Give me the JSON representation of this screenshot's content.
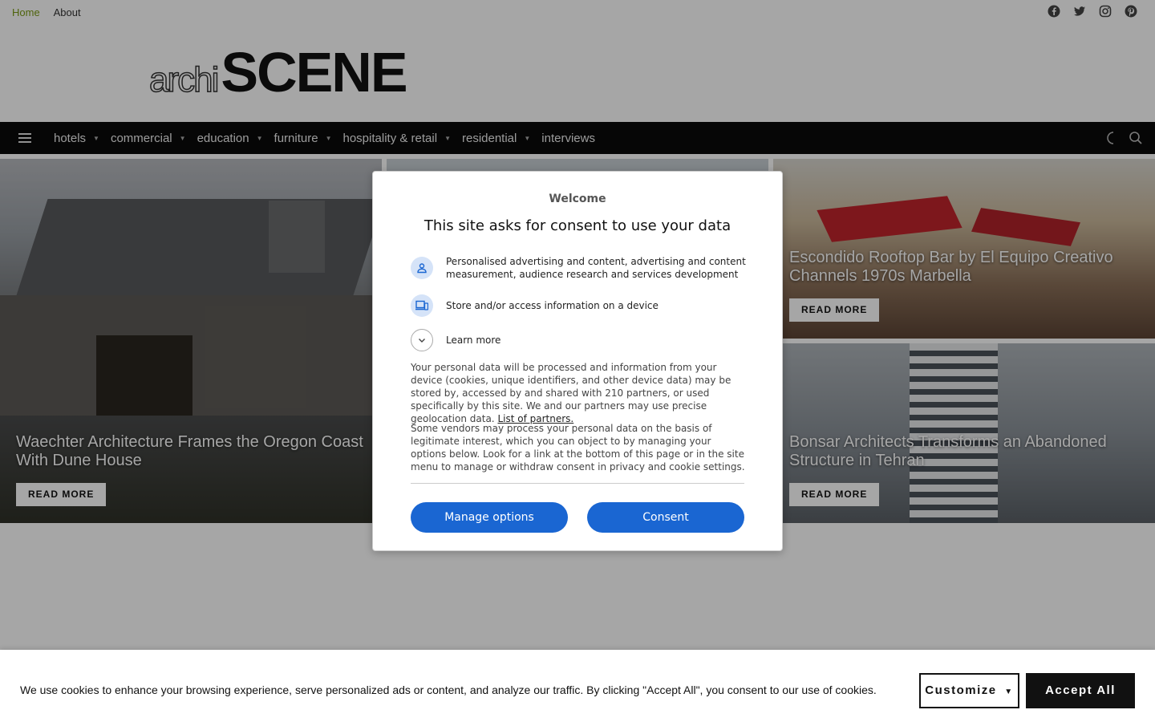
{
  "topbar": {
    "links": [
      {
        "label": "Home"
      },
      {
        "label": "About"
      }
    ],
    "social": [
      "facebook-icon",
      "twitter-icon",
      "instagram-icon",
      "pinterest-icon"
    ]
  },
  "logo": {
    "part1": "archi",
    "part2": "SCENE"
  },
  "nav": {
    "items": [
      {
        "label": "hotels",
        "has_dropdown": true
      },
      {
        "label": "commercial",
        "has_dropdown": true
      },
      {
        "label": "education",
        "has_dropdown": true
      },
      {
        "label": "furniture",
        "has_dropdown": true
      },
      {
        "label": "hospitality & retail",
        "has_dropdown": true
      },
      {
        "label": "residential",
        "has_dropdown": true
      },
      {
        "label": "interviews",
        "has_dropdown": false
      }
    ]
  },
  "articles": [
    {
      "title": "Waechter Architecture Frames the Oregon Coast With Dune House",
      "cta": "READ MORE"
    },
    {
      "title": "Escondido Rooftop Bar by El Equipo Creativo Channels 1970s Marbella",
      "cta": "READ MORE"
    },
    {
      "title": "Bonsar Architects Transforms an Abandoned Structure in Tehran",
      "cta": "READ MORE"
    }
  ],
  "consent": {
    "welcome": "Welcome",
    "headline": "This site asks for consent to use your data",
    "purposes": [
      {
        "icon": "person-icon",
        "text": "Personalised advertising and content, advertising and content measurement, audience research and services development"
      },
      {
        "icon": "devices-icon",
        "text": "Store and/or access information on a device"
      }
    ],
    "learn_more": "Learn more",
    "para1": "Your personal data will be processed and information from your device (cookies, unique identifiers, and other device data) may be stored by, accessed by and shared with 210 partners, or used specifically by this site. We and our partners may use precise geolocation data.",
    "partners_link": "List of partners.",
    "para2": "Some vendors may process your personal data on the basis of legitimate interest, which you can object to by managing your options below. Look for a link at the bottom of this page or in the site menu to manage or withdraw consent in privacy and cookie settings.",
    "manage_button": "Manage options",
    "consent_button": "Consent"
  },
  "cookie_bar": {
    "message": "We use cookies to enhance your browsing experience, serve personalized ads or content, and analyze our traffic. By clicking \"Accept All\", you consent to our use of cookies.",
    "customize": "Customize",
    "accept": "Accept All"
  },
  "colors": {
    "accent_link": "#7a9a13",
    "consent_blue": "#1a66d2",
    "nav_bg": "#0a0a0a"
  }
}
